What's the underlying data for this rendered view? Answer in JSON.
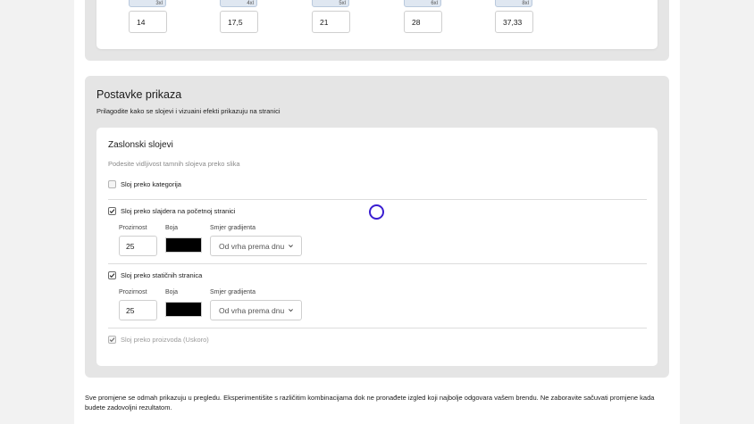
{
  "sizes": [
    {
      "tag": "3xl",
      "value": "14"
    },
    {
      "tag": "4xl",
      "value": "17,5"
    },
    {
      "tag": "5xl",
      "value": "21"
    },
    {
      "tag": "6xl",
      "value": "28"
    },
    {
      "tag": "8xl",
      "value": "37,33"
    }
  ],
  "display": {
    "title": "Postavke prikaza",
    "subtitle": "Prilagodite kako se slojevi i vizuaini efekti prikazuju na stranici",
    "overlays": {
      "title": "Zaslonski slojevi",
      "subtitle": "Podesite vidljivost tamnih slojeva preko slika",
      "category_label": "Sloj preko kategorija",
      "slider_label": "Sloj preko slajdera na početnoj stranici",
      "static_label": "Sloj preko statičnih stranica",
      "products_label": "Sloj preko proizvoda (Uskoro)",
      "slider_fields": {
        "opacity_label": "Prozirnost",
        "opacity_value": "25",
        "color_label": "Boja",
        "color": "#000000",
        "gradient_label": "Smjer gradijenta",
        "gradient_value": "Od vrha prema dnu"
      },
      "static_fields": {
        "opacity_label": "Prozirnost",
        "opacity_value": "25",
        "color_label": "Boja",
        "color": "#000000",
        "gradient_label": "Smjer gradijenta",
        "gradient_value": "Od vrha prema dnu"
      }
    }
  },
  "footer_note": "Sve promjene se odmah prikazuju u pregledu. Eksperimentišite s različitim kombinacijama dok ne pronađete izgled koji najbolje odgovara vašem brendu. Ne zaboravite sačuvati promjene kada budete zadovoljni rezultatom.",
  "icons": {
    "check": "check-icon",
    "chevron": "chevron-down-icon"
  }
}
